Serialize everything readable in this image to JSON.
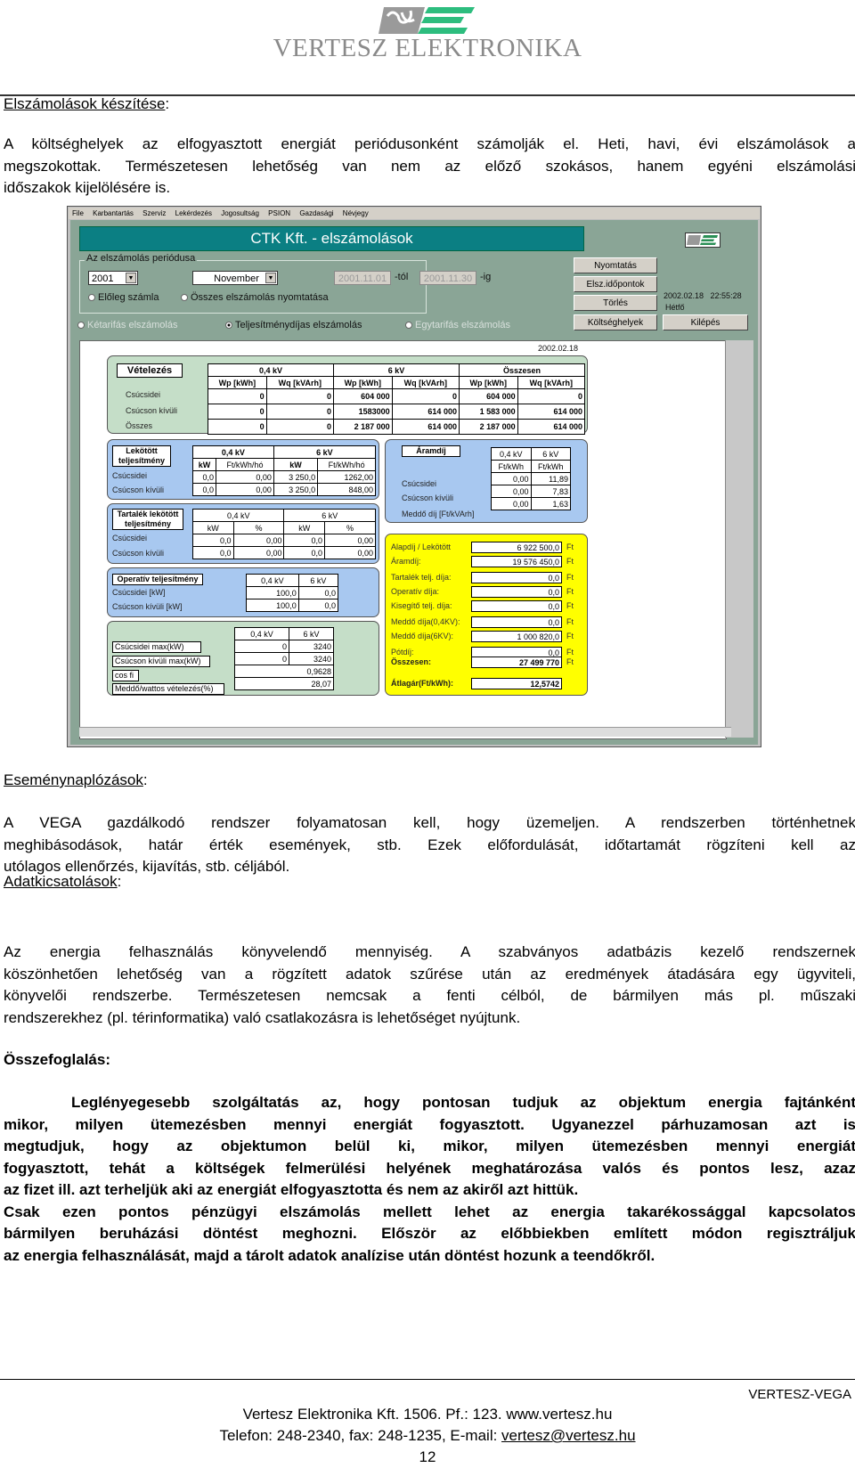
{
  "header": {
    "logo_text": "VERTESZ ELEKTRONIKA",
    "logo_colors": {
      "gray": "#8a8a8a",
      "green": "#2dbd7e"
    }
  },
  "sections": {
    "elszamolasok": {
      "title": "Elszámolások készítése",
      "lines": [
        "A költséghelyek az elfogyasztott energiát periódusonként számolják el. Heti, havi, évi elszámolások a",
        "megszokottak. Természetesen lehetőség van nem az előző szokásos, hanem egyéni elszámolási",
        "időszakok kijelölésére is."
      ]
    },
    "esemenynaplo": {
      "title": "Eseménynaplózások",
      "lines": [
        "A VEGA gazdálkodó rendszer folyamatosan kell, hogy üzemeljen. A rendszerben történhetnek",
        "meghibásodások, határ érték események, stb. Ezek előfordulását, időtartamát rögzíteni kell az",
        "utólagos ellenőrzés, kijavítás, stb. céljából."
      ]
    },
    "adatkicsatolas": {
      "title": "Adatkicsatolások",
      "lines": [
        "Az energia felhasználás könyvelendő mennyiség. A szabványos adatbázis kezelő rendszernek",
        "köszönhetően lehetőség van a rögzített adatok szűrése után az eredmények átadására egy ügyviteli,",
        "könyvelői rendszerbe. Természetesen nemcsak a fenti célból, de bármilyen más pl. műszaki",
        "rendszerekhez (pl. térinformatika) való csatlakozásra is lehetőséget nyújtunk."
      ]
    },
    "osszefoglalas": {
      "title": "Összefoglalás:",
      "lines": [
        "Leglényegesebb szolgáltatás az, hogy pontosan tudjuk az objektum energia fajtánként",
        "mikor, milyen ütemezésben mennyi energiát fogyasztott. Ugyanezzel párhuzamosan azt is",
        "megtudjuk, hogy az objektumon belül ki, mikor, milyen ütemezésben mennyi energiát",
        "fogyasztott, tehát a költségek felmerülési helyének meghatározása valós és pontos lesz, azaz",
        "az fizet ill. azt terheljük aki az energiát elfogyasztotta és nem az akiről azt hittük.",
        "Csak ezen pontos pénzügyi elszámolás mellett lehet az energia takarékossággal kapcsolatos",
        "bármilyen beruházási döntést meghozni. Először az előbbiekben említett módon regisztráljuk",
        "az energia felhasználását, majd a tárolt adatok analízise után döntést hozunk a teendőkről."
      ]
    }
  },
  "app": {
    "menu": [
      "File",
      "Karbantartás",
      "Szerviz",
      "Lekérdezés",
      "Jogosultság",
      "PSION",
      "Gazdasági",
      "Névjegy"
    ],
    "title": "CTK Kft. - elszámolások",
    "period_group_label": "Az elszámolás periódusa",
    "year": "2001",
    "month": "November",
    "date_from": "2001.11.01",
    "date_from_suffix": "-tól",
    "date_to": "2001.11.30",
    "date_to_suffix": "-ig",
    "radio_eloleg": "Előleg számla",
    "radio_osszes": "Összes elszámolás nyomtatása",
    "radio_ketarifas": "Kétarifás elszámolás",
    "radio_teljesitmeny": "Teljesítménydíjas elszámolás",
    "radio_egytarifas": "Egytarifás elszámolás",
    "buttons": {
      "nyomtatas": "Nyomtatás",
      "elsz_idopontok": "Elsz.időpontok",
      "torles": "Törlés",
      "koltseghelyek": "Költséghelyek",
      "kilepes": "Kilépés"
    },
    "datetime": "2002.02.18   22:55:28",
    "weekday": "Hétfő",
    "content_date": "2002.02.18",
    "vetelezes": {
      "label": "Vételezés",
      "groups": [
        "0,4 kV",
        "6 kV",
        "Összesen"
      ],
      "cols": [
        "Wp [kWh]",
        "Wq [kVArh]",
        "Wp [kWh]",
        "Wq [kVArh]",
        "Wp [kWh]",
        "Wq [kVArh]"
      ],
      "rows": [
        {
          "label": "Csúcsidei",
          "values": [
            "0",
            "0",
            "604 000",
            "0",
            "604 000",
            "0"
          ]
        },
        {
          "label": "Csúcson kívüli",
          "values": [
            "0",
            "0",
            "1583000",
            "614 000",
            "1 583 000",
            "614 000"
          ]
        },
        {
          "label": "Összes",
          "values": [
            "0",
            "0",
            "2 187 000",
            "614 000",
            "2 187 000",
            "614 000"
          ]
        }
      ]
    },
    "lekotott": {
      "label1": "Lekötött",
      "label2": "teljesítmény",
      "groups": [
        "0,4 kV",
        "6 kV"
      ],
      "cols": [
        "kW",
        "Ft/kWh/hó",
        "kW",
        "Ft/kWh/hó"
      ],
      "rows": [
        {
          "label": "Csúcsidei",
          "values": [
            "0,0",
            "0,00",
            "3 250,0",
            "1262,00"
          ]
        },
        {
          "label": "Csúcson kívüli",
          "values": [
            "0,0",
            "0,00",
            "3 250,0",
            "848,00"
          ]
        }
      ]
    },
    "tartalek": {
      "label1": "Tartalék lekötött",
      "label2": "teljesítmény",
      "groups": [
        "0,4 kV",
        "6 kV"
      ],
      "cols": [
        "kW",
        "%",
        "kW",
        "%"
      ],
      "rows": [
        {
          "label": "Csúcsidei",
          "values": [
            "0,0",
            "0,00",
            "0,0",
            "0,00"
          ]
        },
        {
          "label": "Csúcson kívüli",
          "values": [
            "0,0",
            "0,00",
            "0,0",
            "0,00"
          ]
        }
      ]
    },
    "operativ": {
      "label": "Operatív teljesítmény",
      "cols": [
        "0,4 kV",
        "6 kV"
      ],
      "rows": [
        {
          "label": "Csúcsidei [kW]",
          "values": [
            "100,0",
            "0,0"
          ]
        },
        {
          "label": "Csúcson kívüli [kW]",
          "values": [
            "100,0",
            "0,0"
          ]
        }
      ]
    },
    "max": {
      "cols": [
        "0,4 kV",
        "6 kV"
      ],
      "rows": [
        {
          "label": "Csúcsidei max(kW)",
          "values": [
            "0",
            "3240"
          ]
        },
        {
          "label": "Csúcson kívüli max(kW)",
          "values": [
            "0",
            "3240"
          ]
        }
      ],
      "cos_label": "cos fi",
      "cos_value": "0,9628",
      "meddo_label": "Meddő/wattos vételezés(%)",
      "meddo_value": "28,07"
    },
    "aramdij": {
      "label": "Áramdíj",
      "cols": [
        "0,4 kV",
        "6 kV"
      ],
      "units": [
        "Ft/kWh",
        "Ft/kWh"
      ],
      "rows": [
        {
          "label": "Csúcsidei",
          "values": [
            "0,00",
            "11,89"
          ]
        },
        {
          "label": "Csúcson kívüli",
          "values": [
            "0,00",
            "7,83"
          ]
        },
        {
          "label": "Meddő díj [Ft/kVArh]",
          "values": [
            "0,00",
            "1,63"
          ]
        }
      ]
    },
    "summary": {
      "currency": "Ft",
      "rows": [
        {
          "label": "Alapdíj / Lekötött",
          "value": "6 922 500,0"
        },
        {
          "label": "Áramdíj:",
          "value": "19 576 450,0"
        },
        {
          "label": "Tartalék telj. díja:",
          "value": "0,0"
        },
        {
          "label": "Operatív díja:",
          "value": "0,0"
        },
        {
          "label": "Kisegítő telj. díja:",
          "value": "0,0"
        },
        {
          "label": "Meddő díja(0,4KV):",
          "value": "0,0"
        },
        {
          "label": "Meddő díja(6KV):",
          "value": "1 000 820,0"
        },
        {
          "label": "Pótdíj:",
          "value": "0,0"
        }
      ],
      "total_label": "Összesen:",
      "total_value": "27 499 770",
      "avg_label": "Átlagár(Ft/kWh):",
      "avg_value": "12,5742"
    }
  },
  "footer": {
    "tag": "VERTESZ-VEGA",
    "line1": "Vertesz Elektronika Kft. 1506. Pf.: 123. www.vertesz.hu",
    "line2_prefix": "Telefon: 248-2340, fax: 248-1235, E-mail: ",
    "email": "vertesz@vertesz.hu",
    "page_number": "12"
  }
}
